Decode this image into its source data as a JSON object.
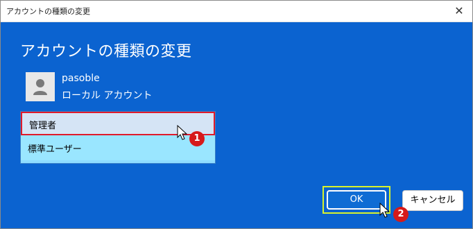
{
  "window": {
    "title": "アカウントの種類の変更",
    "close_glyph": "✕"
  },
  "main": {
    "heading": "アカウントの種類の変更",
    "user": {
      "name": "pasoble",
      "account_type": "ローカル アカウント"
    },
    "dropdown": {
      "options": [
        {
          "label": "管理者",
          "highlighted": true
        },
        {
          "label": "標準ユーザー",
          "highlighted": false
        }
      ]
    }
  },
  "buttons": {
    "ok": "OK",
    "cancel": "キャンセル"
  },
  "annotations": {
    "step1": "1",
    "step2": "2"
  },
  "colors": {
    "panel_bg": "#0b63d0",
    "highlight_red": "#e0192a",
    "highlight_yellow": "#d9f32c",
    "dropdown_bg": "#9ae6ff"
  },
  "icons": [
    "close-icon",
    "user-avatar-icon",
    "mouse-pointer-icon"
  ]
}
